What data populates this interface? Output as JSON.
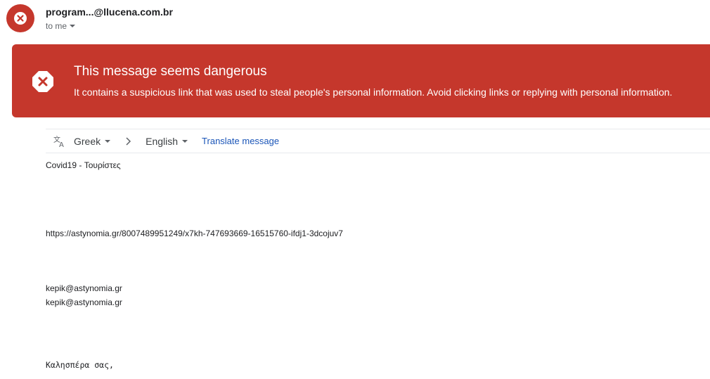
{
  "sender": {
    "display": "program...@llucena.com.br"
  },
  "recipient": {
    "label": "to me"
  },
  "warning": {
    "title": "This message seems dangerous",
    "description": "It contains a suspicious link that was used to steal people's personal information. Avoid clicking links or replying with personal information.",
    "color": "#c5372c"
  },
  "translate": {
    "from": "Greek",
    "to": "English",
    "action": "Translate message",
    "icon": "translate-icon"
  },
  "body": {
    "subject_line": "Covid19 - Τουρίστες",
    "link": "https://astynomia.gr/8007489951249/x7kh-747693669-16515760-ifdj1-3dcojuv7",
    "email1": "kepik@astynomia.gr",
    "email2": "kepik@astynomia.gr",
    "greeting": "Καλησπέρα σας,"
  }
}
